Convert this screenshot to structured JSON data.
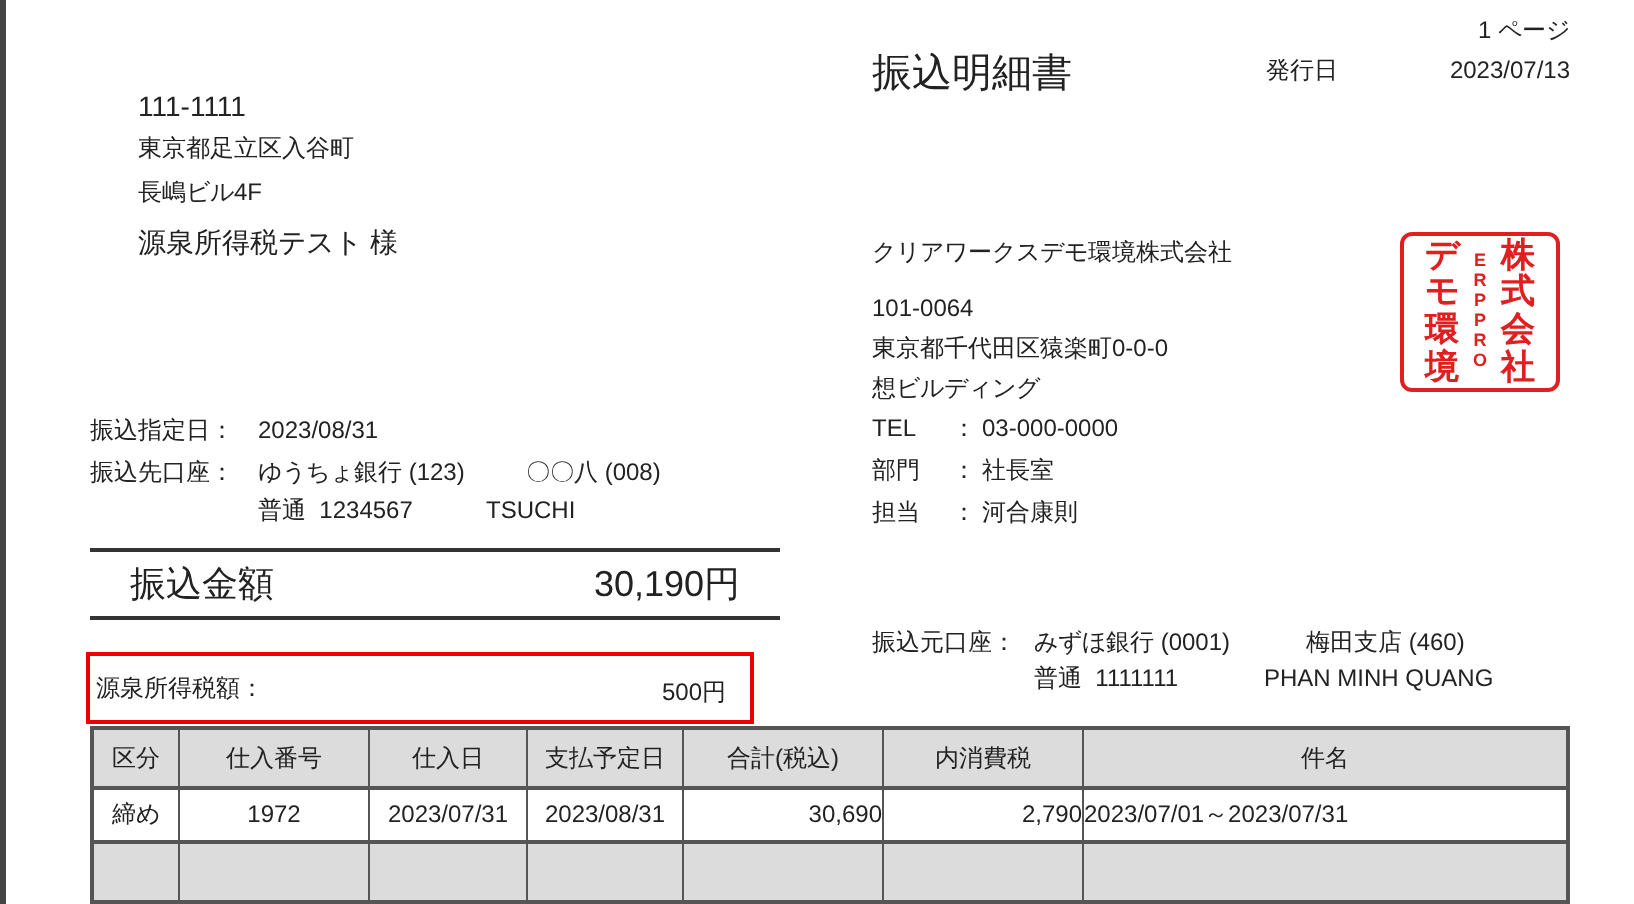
{
  "page_header": {
    "page_number": "1 ページ"
  },
  "recipient": {
    "postal_code": "111-1111",
    "address_lines": [
      "東京都足立区入谷町",
      "長嶋ビル4F"
    ],
    "name": "源泉所得税テスト 様"
  },
  "document": {
    "title": "振込明細書",
    "issue_date_label": "発行日",
    "issue_date": "2023/07/13"
  },
  "issuer": {
    "company": "クリアワークスデモ環境株式会社",
    "postal_code": "101-0064",
    "address": "東京都千代田区猿楽町0-0-0",
    "building": "想ビルディング",
    "contacts": [
      {
        "label": "TEL",
        "separator": "：",
        "value": "03-000-0000"
      },
      {
        "label": "部門",
        "separator": "：",
        "value": "社長室"
      },
      {
        "label": "担当",
        "separator": "：",
        "value": "河合康則"
      }
    ]
  },
  "seal": {
    "columns": [
      "デモ環境",
      "ERPPRO",
      "株式会社"
    ]
  },
  "transfer": {
    "date_label": "振込指定日：",
    "date": "2023/08/31",
    "account_label": "振込先口座：",
    "bank": "ゆうちょ銀行 (123)",
    "branch": "〇〇八 (008)",
    "account": "普通  1234567",
    "holder": "TSUCHI"
  },
  "amount": {
    "label": "振込金額",
    "value": "30,190円"
  },
  "withholding": {
    "label": "源泉所得税額：",
    "value": "500円"
  },
  "source_account": {
    "label": "振込元口座：",
    "bank": "みずほ銀行 (0001)",
    "branch": "梅田支店 (460)",
    "account": "普通  1111111",
    "holder": "PHAN MINH QUANG"
  },
  "table": {
    "columns": [
      "区分",
      "仕入番号",
      "仕入日",
      "支払予定日",
      "合計(税込)",
      "内消費税",
      "件名"
    ],
    "rows": [
      [
        "締め",
        "1972",
        "2023/07/31",
        "2023/08/31",
        "30,690",
        "2,790",
        "2023/07/01～2023/07/31"
      ]
    ]
  }
}
